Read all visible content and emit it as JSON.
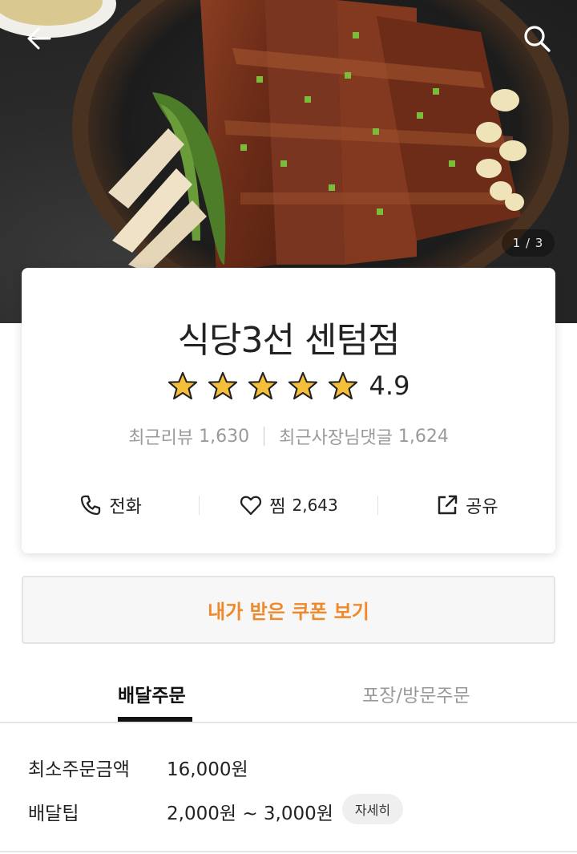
{
  "hero": {
    "pager": "1 / 3",
    "icons": {
      "back": "arrow-left-icon",
      "search": "search-icon"
    }
  },
  "store": {
    "name": "식당3선 센텀점",
    "rating": "4.9",
    "rating_stars": 5,
    "review_label": "최근리뷰",
    "review_count": "1,630",
    "owner_reply_label": "최근사장님댓글",
    "owner_reply_count": "1,624"
  },
  "actions": {
    "call_label": "전화",
    "like_label": "찜",
    "like_count": "2,643",
    "share_label": "공유"
  },
  "coupon": {
    "label": "내가 받은 쿠폰 보기",
    "color": "#ef8a2c"
  },
  "tabs": [
    {
      "label": "배달주문",
      "active": true
    },
    {
      "label": "포장/방문주문",
      "active": false
    }
  ],
  "delivery_info": {
    "min_order_label": "최소주문금액",
    "min_order_value": "16,000원",
    "tip_label": "배달팁",
    "tip_value": "2,000원 ~ 3,000원",
    "detail_label": "자세히"
  }
}
